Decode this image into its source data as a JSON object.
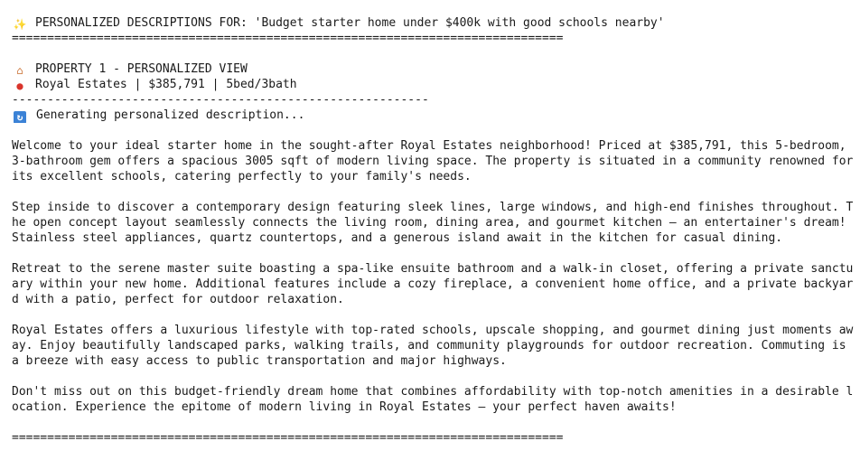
{
  "header": {
    "icon": "sparkles-icon",
    "title": "PERSONALIZED DESCRIPTIONS FOR: 'Budget starter home under $400k with good schools nearby'",
    "rule": "=============================================================================="
  },
  "property": {
    "icon": "house-icon",
    "heading": "PROPERTY 1 - PERSONALIZED VIEW",
    "pin_icon": "pin-icon",
    "summary": "Royal Estates | $385,791 | 5bed/3bath",
    "dash_rule": "-----------------------------------------------------------",
    "status_icon": "refresh-icon",
    "status": "Generating personalized description..."
  },
  "paragraphs": [
    [
      "Welcome to your ideal starter home in the sought-after Royal Estates neighborhood! Priced at $385,791, this 5-bedroom,",
      "3-bathroom gem offers a spacious 3005 sqft of modern living space. The property is situated in a community renowned for",
      "its excellent schools, catering perfectly to your family's needs."
    ],
    [
      "Step inside to discover a contemporary design featuring sleek lines, large windows, and high-end finishes throughout. T",
      "he open concept layout seamlessly connects the living room, dining area, and gourmet kitchen – an entertainer's dream!",
      "Stainless steel appliances, quartz countertops, and a generous island await in the kitchen for casual dining."
    ],
    [
      "Retreat to the serene master suite boasting a spa-like ensuite bathroom and a walk-in closet, offering a private sanctu",
      "ary within your new home. Additional features include a cozy fireplace, a convenient home office, and a private backyar",
      "d with a patio, perfect for outdoor relaxation."
    ],
    [
      "Royal Estates offers a luxurious lifestyle with top-rated schools, upscale shopping, and gourmet dining just moments aw",
      "ay. Enjoy beautifully landscaped parks, walking trails, and community playgrounds for outdoor recreation. Commuting is",
      "a breeze with easy access to public transportation and major highways."
    ],
    [
      "Don't miss out on this budget-friendly dream home that combines affordability with top-notch amenities in a desirable l",
      "ocation. Experience the epitome of modern living in Royal Estates – your perfect haven awaits!"
    ]
  ],
  "footer": {
    "rule": "=============================================================================="
  }
}
